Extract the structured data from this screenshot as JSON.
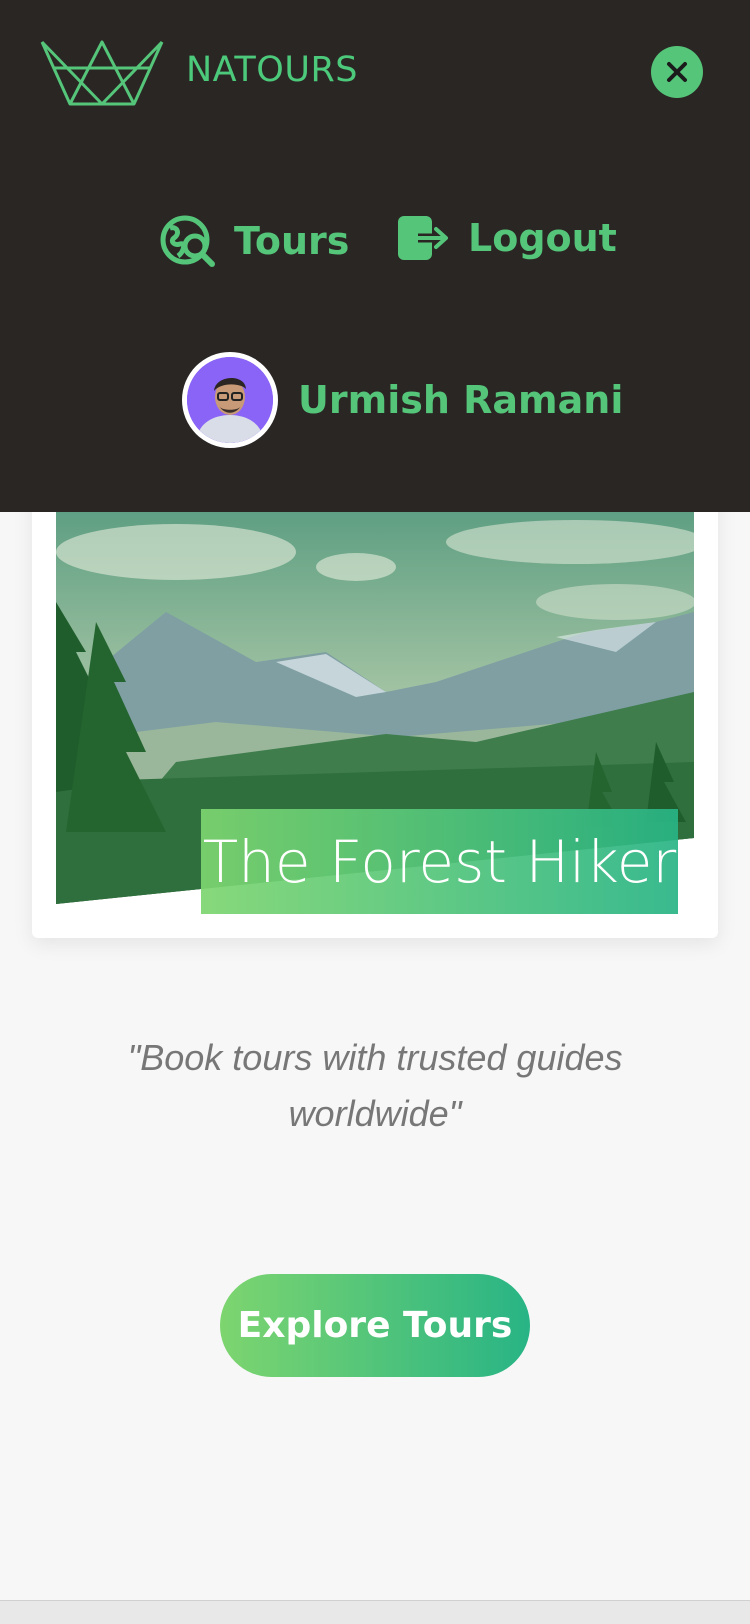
{
  "header": {
    "brand": "NATOURS",
    "logo_icon": "crown-logo-icon",
    "close_icon": "close-icon"
  },
  "nav": {
    "items": [
      {
        "label": "Tours",
        "icon": "globe-search-icon"
      },
      {
        "label": "Logout",
        "icon": "logout-icon"
      }
    ],
    "user": {
      "name": "Urmish Ramani",
      "avatar": "user-avatar"
    }
  },
  "hero": {
    "title": "The Forest Hiker",
    "image": "forest-mountain-landscape"
  },
  "tagline": "\"Book tours with trusted guides worldwide\"",
  "cta": {
    "label": "Explore Tours"
  },
  "colors": {
    "accent": "#55c57a",
    "gradient_start": "#7dd56f",
    "gradient_end": "#28b485",
    "nav_bg": "#2a2624",
    "page_bg": "#f7f7f7"
  }
}
